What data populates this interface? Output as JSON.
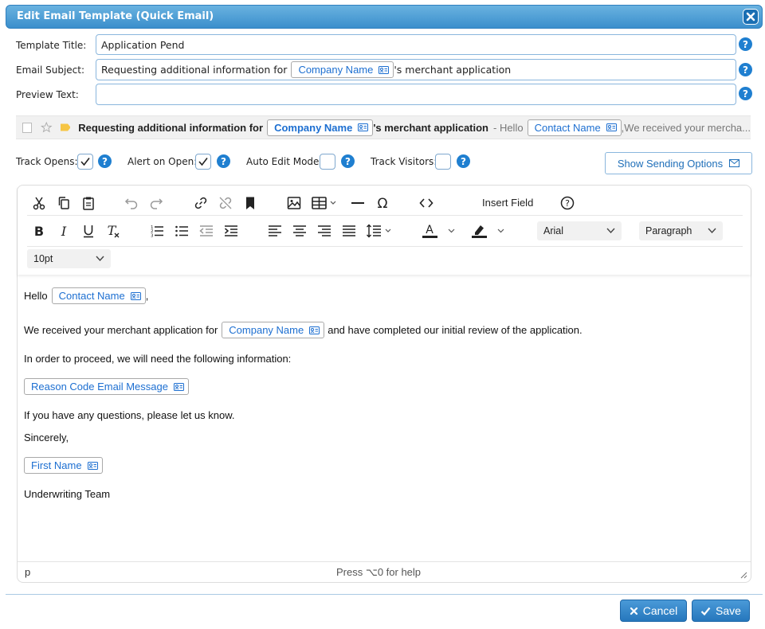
{
  "dialog": {
    "title": "Edit Email Template (Quick Email)"
  },
  "form": {
    "template_title_label": "Template Title:",
    "template_title_value": "Application Pend",
    "email_subject_label": "Email Subject:",
    "subject_before": "Requesting additional information for",
    "subject_chip": "Company Name",
    "subject_after": "'s merchant application",
    "preview_text_label": "Preview Text:",
    "preview_text_value": ""
  },
  "preview": {
    "subject_before": "Requesting additional information for",
    "subject_chip": "Company Name",
    "subject_after": "'s merchant application",
    "snippet_prefix": "- Hello",
    "snippet_chip": "Contact Name",
    "snippet_after": ",We received your mercha..."
  },
  "options": {
    "track_opens_label": "Track Opens:",
    "track_opens": true,
    "alert_on_open_label": "Alert on Open:",
    "alert_on_open": true,
    "auto_edit_label": "Auto Edit Mode:",
    "auto_edit": false,
    "track_visitors_label": "Track Visitors:",
    "track_visitors": false,
    "show_sending_options": "Show Sending Options"
  },
  "toolbar": {
    "insert_field": "Insert Field",
    "font_family": "Arial",
    "block_format": "Paragraph",
    "font_size": "10pt"
  },
  "body": {
    "hello": "Hello",
    "contact_chip": "Contact Name",
    "comma": ",",
    "received_before": "We received your merchant application for",
    "company_chip": "Company Name",
    "received_after": "and have completed our initial review of the application.",
    "proceed": "In order to proceed, we will need the following information:",
    "reason_chip": "Reason Code Email Message",
    "questions": "If you have any questions, please let us know.",
    "sincerely": "Sincerely,",
    "first_name_chip": "First Name",
    "team": "Underwriting Team"
  },
  "status": {
    "path": "p",
    "help": "Press ⌥0 for help"
  },
  "buttons": {
    "cancel": "Cancel",
    "save": "Save"
  },
  "colors": {
    "accent": "#2677bc",
    "chip_text": "#1d6fd1",
    "title_bar": "#4a9ad8"
  }
}
